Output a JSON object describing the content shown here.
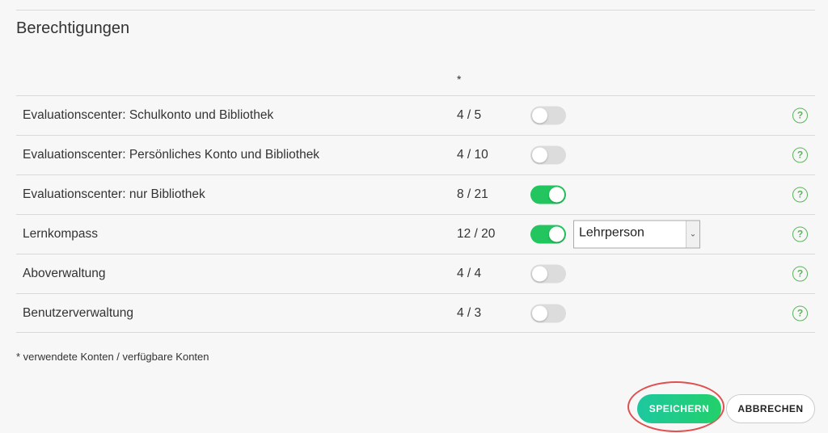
{
  "section": {
    "title": "Berechtigungen",
    "column_header": "*"
  },
  "rows": [
    {
      "label": "Evaluationscenter: Schulkonto und Bibliothek",
      "count": "4 / 5",
      "enabled": false
    },
    {
      "label": "Evaluationscenter: Persönliches Konto und Bibliothek",
      "count": "4 / 10",
      "enabled": false
    },
    {
      "label": "Evaluationscenter: nur Bibliothek",
      "count": "8 / 21",
      "enabled": true
    },
    {
      "label": "Lernkompass",
      "count": "12 / 20",
      "enabled": true,
      "role_select": "Lehrperson"
    },
    {
      "label": "Aboverwaltung",
      "count": "4 / 4",
      "enabled": false
    },
    {
      "label": "Benutzerverwaltung",
      "count": "4 / 3",
      "enabled": false
    }
  ],
  "help_icon_glyph": "?",
  "footnote": "* verwendete Konten / verfügbare Konten",
  "buttons": {
    "save": "SPEICHERN",
    "cancel": "ABBRECHEN"
  },
  "colors": {
    "toggle_on": "#22c55e",
    "toggle_off": "#dcdcdc",
    "help_icon": "#5ab45a",
    "highlight_ring": "#e05050"
  }
}
